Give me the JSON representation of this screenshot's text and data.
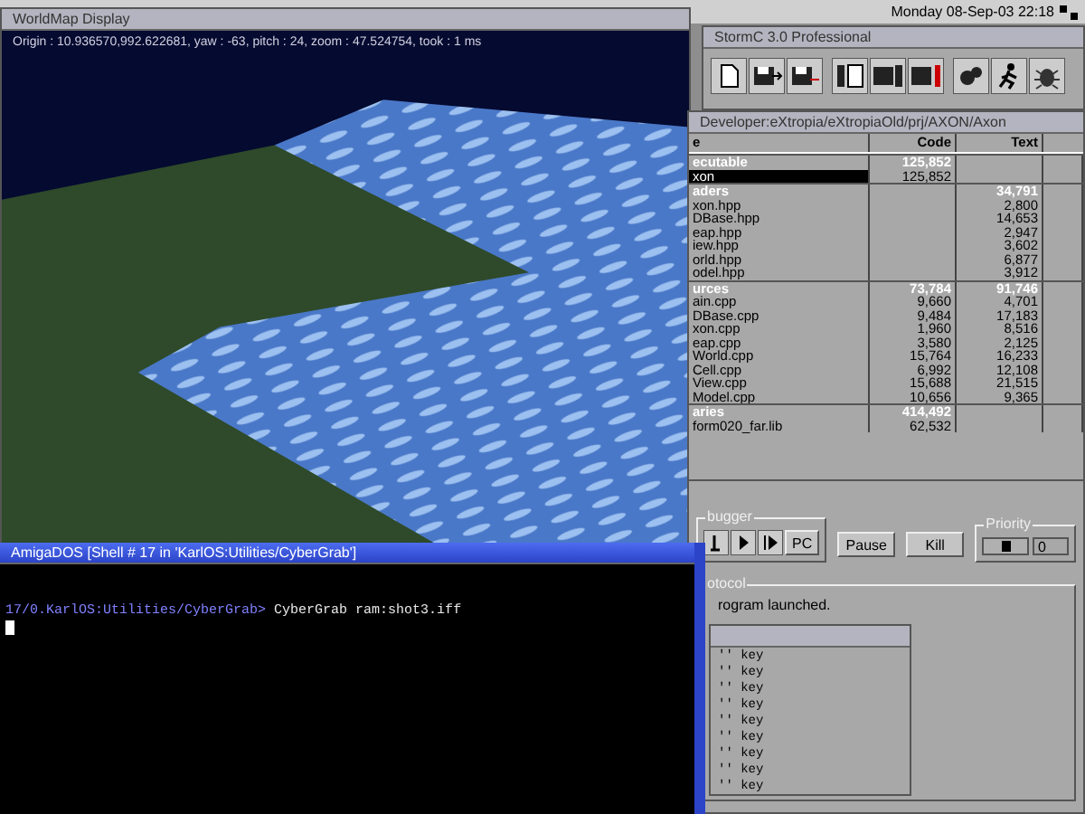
{
  "screen": {
    "clock": "Monday 08-Sep-03 22:18"
  },
  "worldmap": {
    "title": "WorldMap Display",
    "status": "Origin : 10.936570,992.622681, yaw : -63, pitch : 24, zoom : 47.524754, took : 1 ms"
  },
  "stormc": {
    "title": "StormC 3.0 Professional"
  },
  "project": {
    "title": "Developer:eXtropia/eXtropiaOld/prj/AXON/Axon",
    "columns": [
      "e",
      "Code",
      "Text"
    ],
    "rows": [
      {
        "kind": "section",
        "name": "ecutable",
        "code": "125,852",
        "text": "",
        "selected": false
      },
      {
        "kind": "file",
        "name": "xon",
        "code": "125,852",
        "text": "",
        "selected": true
      },
      {
        "kind": "section",
        "name": "aders",
        "code": "",
        "text": "34,791",
        "selected": false
      },
      {
        "kind": "file",
        "name": "xon.hpp",
        "code": "",
        "text": "2,800",
        "selected": false
      },
      {
        "kind": "file",
        "name": "DBase.hpp",
        "code": "",
        "text": "14,653",
        "selected": false
      },
      {
        "kind": "file",
        "name": "eap.hpp",
        "code": "",
        "text": "2,947",
        "selected": false
      },
      {
        "kind": "file",
        "name": "iew.hpp",
        "code": "",
        "text": "3,602",
        "selected": false
      },
      {
        "kind": "file",
        "name": "orld.hpp",
        "code": "",
        "text": "6,877",
        "selected": false
      },
      {
        "kind": "file",
        "name": "odel.hpp",
        "code": "",
        "text": "3,912",
        "selected": false
      },
      {
        "kind": "section",
        "name": "urces",
        "code": "73,784",
        "text": "91,746",
        "selected": false
      },
      {
        "kind": "file",
        "name": "ain.cpp",
        "code": "9,660",
        "text": "4,701",
        "selected": false
      },
      {
        "kind": "file",
        "name": "DBase.cpp",
        "code": "9,484",
        "text": "17,183",
        "selected": false
      },
      {
        "kind": "file",
        "name": "xon.cpp",
        "code": "1,960",
        "text": "8,516",
        "selected": false
      },
      {
        "kind": "file",
        "name": "eap.cpp",
        "code": "3,580",
        "text": "2,125",
        "selected": false
      },
      {
        "kind": "file",
        "name": "World.cpp",
        "code": "15,764",
        "text": "16,233",
        "selected": false
      },
      {
        "kind": "file",
        "name": "Cell.cpp",
        "code": "6,992",
        "text": "12,108",
        "selected": false
      },
      {
        "kind": "file",
        "name": "View.cpp",
        "code": "15,688",
        "text": "21,515",
        "selected": false
      },
      {
        "kind": "file",
        "name": "Model.cpp",
        "code": "10,656",
        "text": "9,365",
        "selected": false
      },
      {
        "kind": "section",
        "name": "aries",
        "code": "414,492",
        "text": "",
        "selected": false
      },
      {
        "kind": "file",
        "name": "form020_far.lib",
        "code": "62,532",
        "text": "",
        "selected": false
      }
    ]
  },
  "debugger": {
    "group_label": "bugger",
    "pc_label": "PC",
    "buttons": [
      "Pause",
      "Kill"
    ],
    "priority_label": "Priority",
    "level": 0.5,
    "priority_value": "0",
    "protocol_label": "otocol",
    "protocol_lines": [
      "rogram launched."
    ]
  },
  "shell": {
    "title": "AmigaDOS [Shell # 17 in 'KarlOS:Utilities/CyberGrab']",
    "prompt": "17/0.KarlOS:Utilities/CyberGrab>",
    "command": "CyberGrab ram:shot3.iff"
  },
  "keys": {
    "items": [
      "'' key",
      "'' key",
      "'' key",
      "'' key",
      "'' key",
      "'' key",
      "'' key",
      "'' key",
      "'' key"
    ]
  }
}
